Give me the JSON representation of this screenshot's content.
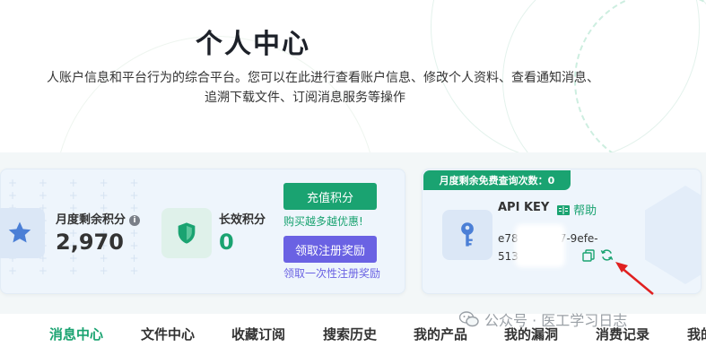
{
  "hero": {
    "title": "个人中心",
    "desc_line1": "人账户信息和平台行为的综合平台。您可以在此进行查看账户信息、修改个人资料、查看通知消息、",
    "desc_line2": "追溯下载文件、订阅消息服务等操作"
  },
  "points": {
    "monthly_label": "月度剩余积分",
    "monthly_value": "2,970",
    "long_label": "长效积分",
    "long_value": "0",
    "recharge_button": "充值积分",
    "recharge_note": "购买越多越优惠!",
    "claim_button": "领取注册奖励",
    "claim_note": "领取一次性注册奖励",
    "info_icon": "i"
  },
  "api": {
    "quota_badge": "月度剩余免费查询次数：0",
    "title": "API KEY",
    "help_label": "帮助",
    "key_line1": "e78         e6-4257-9efe-",
    "key_line2": "513f2          52"
  },
  "tabs": [
    "消息中心",
    "文件中心",
    "收藏订阅",
    "搜索历史",
    "我的产品",
    "我的漏洞",
    "消费记录",
    "我的"
  ],
  "watermark": "公众号 · 医工学习日志",
  "colors": {
    "accent_green": "#1aa371",
    "accent_purple": "#6a62e3",
    "link_purple": "#6a62e3",
    "card_bg": "#eef5fc"
  },
  "icons": {
    "star": "star-icon",
    "shield": "shield-icon",
    "key": "key-icon",
    "help": "book-icon",
    "copy": "copy-icon",
    "refresh": "refresh-icon"
  }
}
